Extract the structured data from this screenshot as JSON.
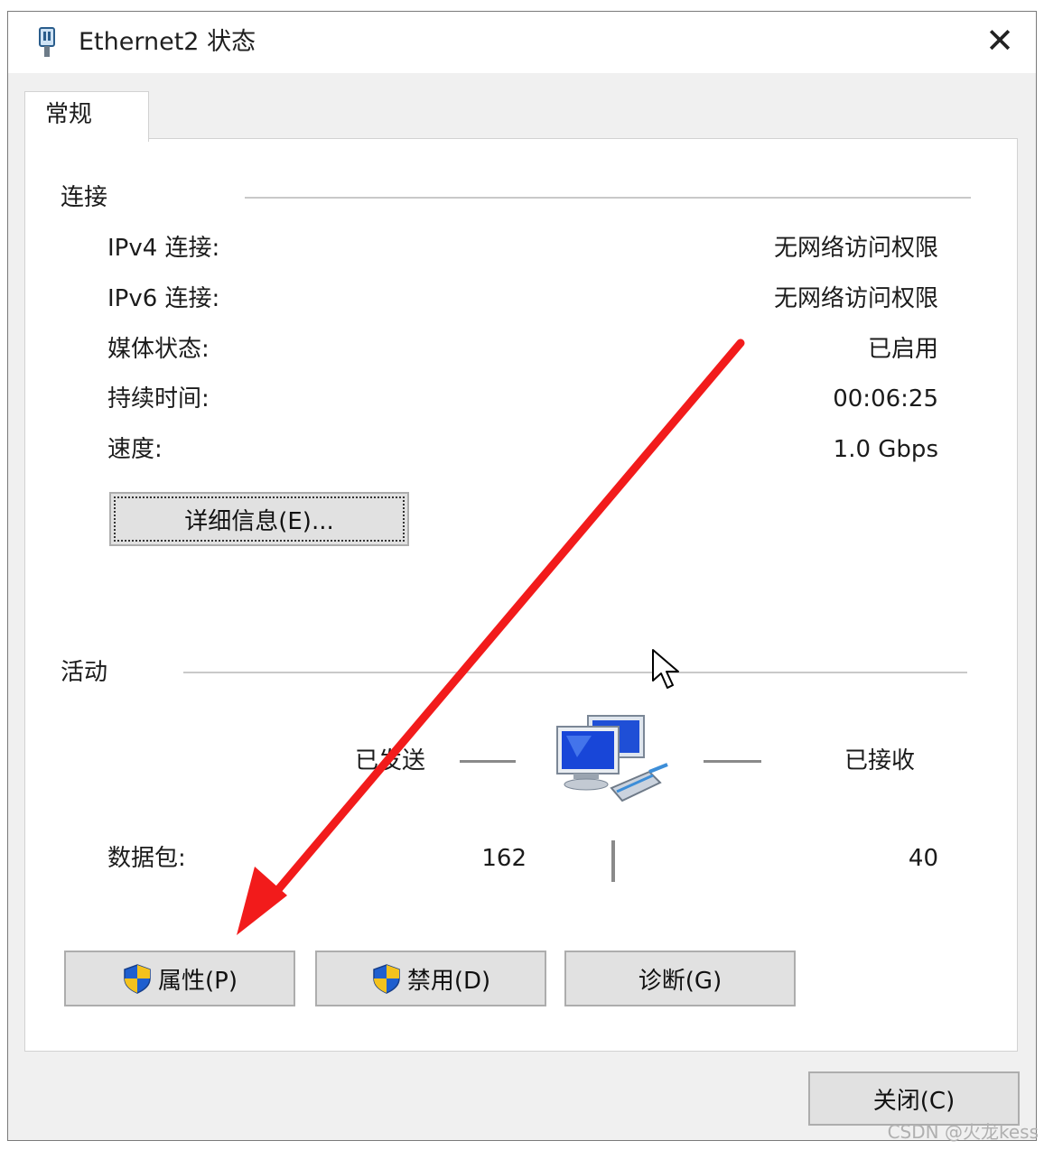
{
  "window": {
    "title": "Ethernet2 状态",
    "close_glyph": "✕",
    "icon": "network-adapter-icon"
  },
  "tabs": [
    {
      "label": "常规"
    }
  ],
  "connection": {
    "header": "连接",
    "rows": [
      {
        "label": "IPv4 连接:",
        "value": "无网络访问权限"
      },
      {
        "label": "IPv6 连接:",
        "value": "无网络访问权限"
      },
      {
        "label": "媒体状态:",
        "value": "已启用"
      },
      {
        "label": "持续时间:",
        "value": "00:06:25"
      },
      {
        "label": "速度:",
        "value": "1.0 Gbps"
      }
    ],
    "details_button": "详细信息(E)..."
  },
  "activity": {
    "header": "活动",
    "sent_label": "已发送",
    "received_label": "已接收",
    "packets_label": "数据包:",
    "packets_sent": "162",
    "packets_received": "40",
    "icon": "network-computers-icon"
  },
  "buttons": {
    "properties": "属性(P)",
    "disable": "禁用(D)",
    "diagnose": "诊断(G)",
    "close": "关闭(C)",
    "shield_icon": "uac-shield-icon"
  },
  "annotation": {
    "arrow_color": "#f21b1b"
  },
  "watermark": "CSDN @火龙kess"
}
